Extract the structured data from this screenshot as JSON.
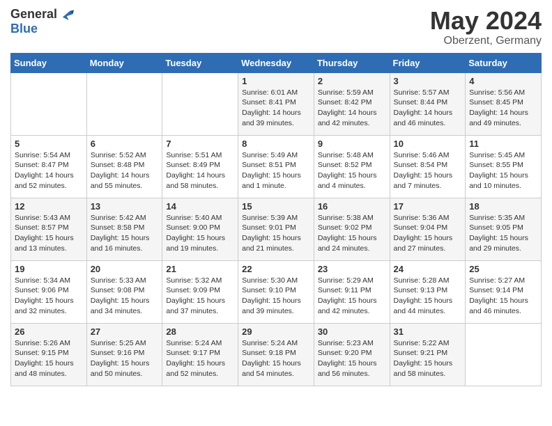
{
  "logo": {
    "general": "General",
    "blue": "Blue"
  },
  "title": "May 2024",
  "subtitle": "Oberzent, Germany",
  "days_of_week": [
    "Sunday",
    "Monday",
    "Tuesday",
    "Wednesday",
    "Thursday",
    "Friday",
    "Saturday"
  ],
  "weeks": [
    [
      {
        "day": "",
        "info": ""
      },
      {
        "day": "",
        "info": ""
      },
      {
        "day": "",
        "info": ""
      },
      {
        "day": "1",
        "info": "Sunrise: 6:01 AM\nSunset: 8:41 PM\nDaylight: 14 hours\nand 39 minutes."
      },
      {
        "day": "2",
        "info": "Sunrise: 5:59 AM\nSunset: 8:42 PM\nDaylight: 14 hours\nand 42 minutes."
      },
      {
        "day": "3",
        "info": "Sunrise: 5:57 AM\nSunset: 8:44 PM\nDaylight: 14 hours\nand 46 minutes."
      },
      {
        "day": "4",
        "info": "Sunrise: 5:56 AM\nSunset: 8:45 PM\nDaylight: 14 hours\nand 49 minutes."
      }
    ],
    [
      {
        "day": "5",
        "info": "Sunrise: 5:54 AM\nSunset: 8:47 PM\nDaylight: 14 hours\nand 52 minutes."
      },
      {
        "day": "6",
        "info": "Sunrise: 5:52 AM\nSunset: 8:48 PM\nDaylight: 14 hours\nand 55 minutes."
      },
      {
        "day": "7",
        "info": "Sunrise: 5:51 AM\nSunset: 8:49 PM\nDaylight: 14 hours\nand 58 minutes."
      },
      {
        "day": "8",
        "info": "Sunrise: 5:49 AM\nSunset: 8:51 PM\nDaylight: 15 hours\nand 1 minute."
      },
      {
        "day": "9",
        "info": "Sunrise: 5:48 AM\nSunset: 8:52 PM\nDaylight: 15 hours\nand 4 minutes."
      },
      {
        "day": "10",
        "info": "Sunrise: 5:46 AM\nSunset: 8:54 PM\nDaylight: 15 hours\nand 7 minutes."
      },
      {
        "day": "11",
        "info": "Sunrise: 5:45 AM\nSunset: 8:55 PM\nDaylight: 15 hours\nand 10 minutes."
      }
    ],
    [
      {
        "day": "12",
        "info": "Sunrise: 5:43 AM\nSunset: 8:57 PM\nDaylight: 15 hours\nand 13 minutes."
      },
      {
        "day": "13",
        "info": "Sunrise: 5:42 AM\nSunset: 8:58 PM\nDaylight: 15 hours\nand 16 minutes."
      },
      {
        "day": "14",
        "info": "Sunrise: 5:40 AM\nSunset: 9:00 PM\nDaylight: 15 hours\nand 19 minutes."
      },
      {
        "day": "15",
        "info": "Sunrise: 5:39 AM\nSunset: 9:01 PM\nDaylight: 15 hours\nand 21 minutes."
      },
      {
        "day": "16",
        "info": "Sunrise: 5:38 AM\nSunset: 9:02 PM\nDaylight: 15 hours\nand 24 minutes."
      },
      {
        "day": "17",
        "info": "Sunrise: 5:36 AM\nSunset: 9:04 PM\nDaylight: 15 hours\nand 27 minutes."
      },
      {
        "day": "18",
        "info": "Sunrise: 5:35 AM\nSunset: 9:05 PM\nDaylight: 15 hours\nand 29 minutes."
      }
    ],
    [
      {
        "day": "19",
        "info": "Sunrise: 5:34 AM\nSunset: 9:06 PM\nDaylight: 15 hours\nand 32 minutes."
      },
      {
        "day": "20",
        "info": "Sunrise: 5:33 AM\nSunset: 9:08 PM\nDaylight: 15 hours\nand 34 minutes."
      },
      {
        "day": "21",
        "info": "Sunrise: 5:32 AM\nSunset: 9:09 PM\nDaylight: 15 hours\nand 37 minutes."
      },
      {
        "day": "22",
        "info": "Sunrise: 5:30 AM\nSunset: 9:10 PM\nDaylight: 15 hours\nand 39 minutes."
      },
      {
        "day": "23",
        "info": "Sunrise: 5:29 AM\nSunset: 9:11 PM\nDaylight: 15 hours\nand 42 minutes."
      },
      {
        "day": "24",
        "info": "Sunrise: 5:28 AM\nSunset: 9:13 PM\nDaylight: 15 hours\nand 44 minutes."
      },
      {
        "day": "25",
        "info": "Sunrise: 5:27 AM\nSunset: 9:14 PM\nDaylight: 15 hours\nand 46 minutes."
      }
    ],
    [
      {
        "day": "26",
        "info": "Sunrise: 5:26 AM\nSunset: 9:15 PM\nDaylight: 15 hours\nand 48 minutes."
      },
      {
        "day": "27",
        "info": "Sunrise: 5:25 AM\nSunset: 9:16 PM\nDaylight: 15 hours\nand 50 minutes."
      },
      {
        "day": "28",
        "info": "Sunrise: 5:24 AM\nSunset: 9:17 PM\nDaylight: 15 hours\nand 52 minutes."
      },
      {
        "day": "29",
        "info": "Sunrise: 5:24 AM\nSunset: 9:18 PM\nDaylight: 15 hours\nand 54 minutes."
      },
      {
        "day": "30",
        "info": "Sunrise: 5:23 AM\nSunset: 9:20 PM\nDaylight: 15 hours\nand 56 minutes."
      },
      {
        "day": "31",
        "info": "Sunrise: 5:22 AM\nSunset: 9:21 PM\nDaylight: 15 hours\nand 58 minutes."
      },
      {
        "day": "",
        "info": ""
      }
    ]
  ]
}
